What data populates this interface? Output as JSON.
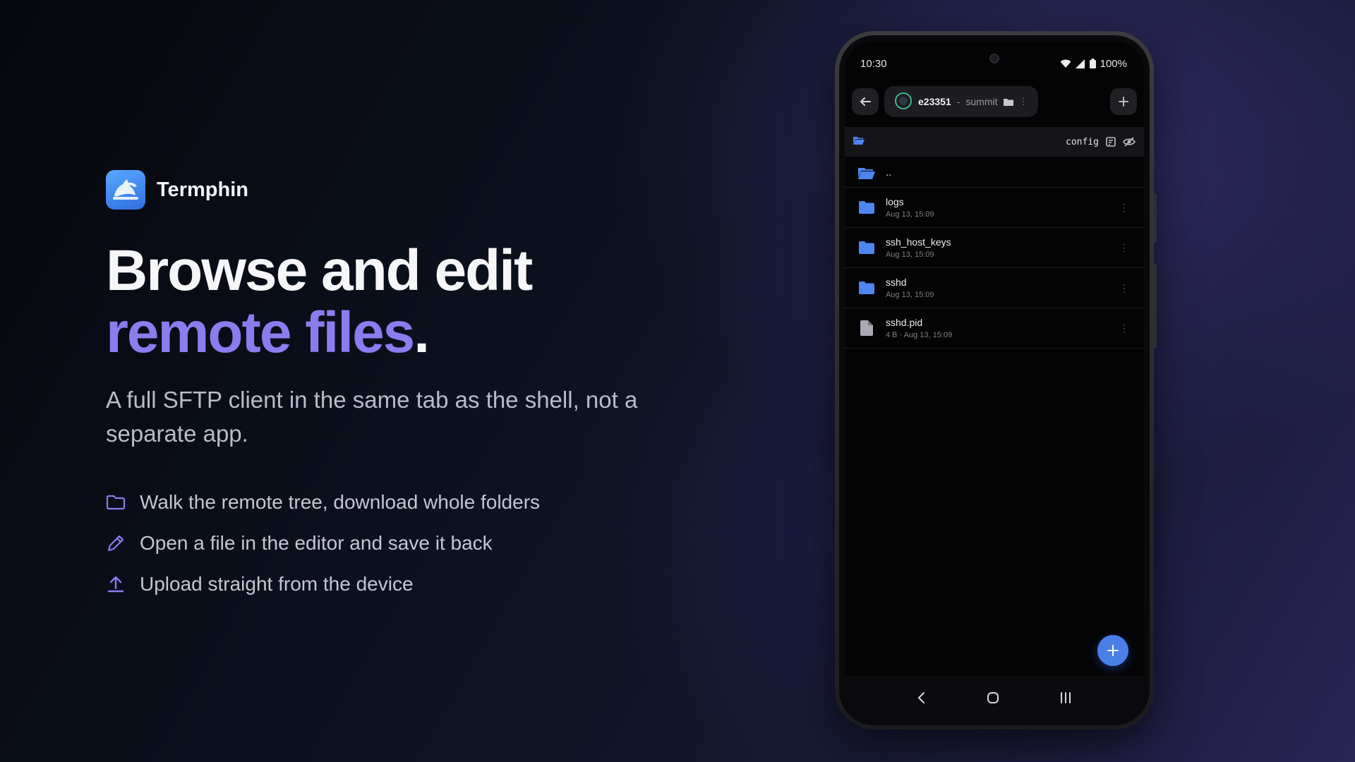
{
  "brand": {
    "name": "Termphin",
    "logo_icon": "dolphin-icon",
    "accent": "#3b82f6"
  },
  "hero": {
    "headline_line1": "Browse and edit",
    "headline_line2": "remote files",
    "headline_period": ".",
    "accent_color": "#8b7cf0",
    "subtitle": "A full SFTP client in the same tab as the shell, not a separate app."
  },
  "features": [
    {
      "icon": "folder-icon",
      "text": "Walk the remote tree, download whole folders"
    },
    {
      "icon": "pencil-icon",
      "text": "Open a file in the editor and save it back"
    },
    {
      "icon": "upload-icon",
      "text": "Upload straight from the device"
    }
  ],
  "phone": {
    "status": {
      "time": "10:30",
      "battery": "100%"
    },
    "tab": {
      "host": "e23351",
      "separator": "-",
      "user": "summit"
    },
    "path": {
      "current": "config"
    },
    "parent_label": "..",
    "files": [
      {
        "name": "logs",
        "type": "folder",
        "meta": "Aug 13, 15:09"
      },
      {
        "name": "ssh_host_keys",
        "type": "folder",
        "meta": "Aug 13, 15:09"
      },
      {
        "name": "sshd",
        "type": "folder",
        "meta": "Aug 13, 15:09"
      },
      {
        "name": "sshd.pid",
        "type": "file",
        "meta": "4 B · Aug 13, 15:09"
      }
    ],
    "fab_icon": "plus-icon"
  }
}
